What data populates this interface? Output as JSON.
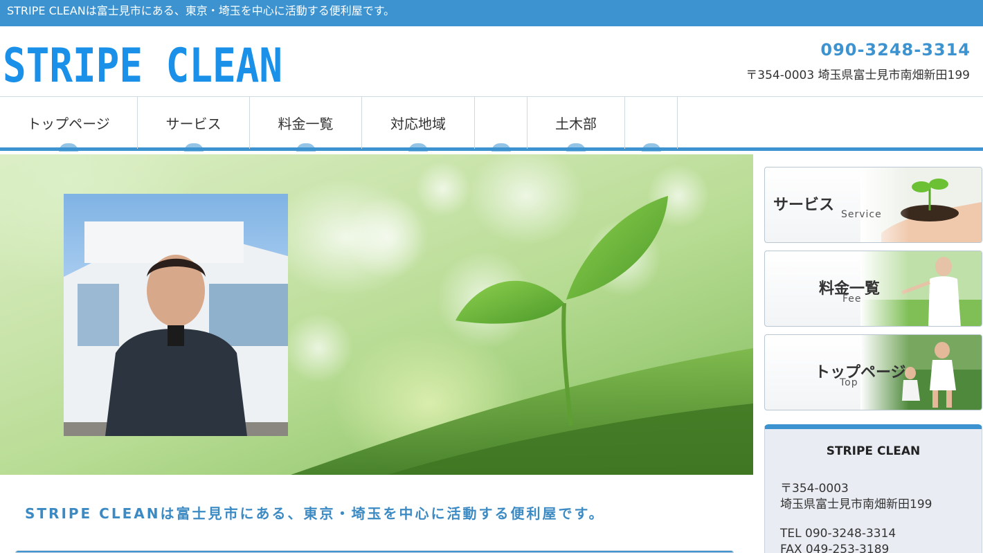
{
  "topbar": {
    "text": "STRIPE CLEANは富士見市にある、東京・埼玉を中心に活動する便利屋です。"
  },
  "header": {
    "logo_text": "STRIPE CLEAN",
    "phone": "090-3248-3314",
    "address": "〒354-0003 埼玉県富士見市南畑新田199"
  },
  "nav": {
    "items": [
      {
        "label": "トップページ"
      },
      {
        "label": "サービス"
      },
      {
        "label": "料金一覧"
      },
      {
        "label": "対応地域"
      },
      {
        "label": ""
      },
      {
        "label": "土木部"
      },
      {
        "label": ""
      }
    ]
  },
  "sidebar": {
    "buttons": [
      {
        "label": "サービス",
        "sub": "Service"
      },
      {
        "label": "料金一覧",
        "sub": "Fee"
      },
      {
        "label": "トップページ",
        "sub": "Top"
      }
    ],
    "info": {
      "name": "STRIPE CLEAN",
      "postal": "〒354-0003",
      "address": "埼玉県富士見市南畑新田199",
      "tel": "TEL 090-3248-3314",
      "fax": "FAX 049-253-3189"
    }
  },
  "main": {
    "tagline": "STRIPE CLEANは富士見市にある、東京・埼玉を中心に活動する便利屋です。"
  },
  "colors": {
    "accent": "#3c93cf",
    "text": "#333333",
    "info_bg": "#e9edf3"
  },
  "icons": {
    "service": "hands-seedling-icon",
    "fee": "woman-meadow-icon",
    "top": "children-running-icon"
  }
}
